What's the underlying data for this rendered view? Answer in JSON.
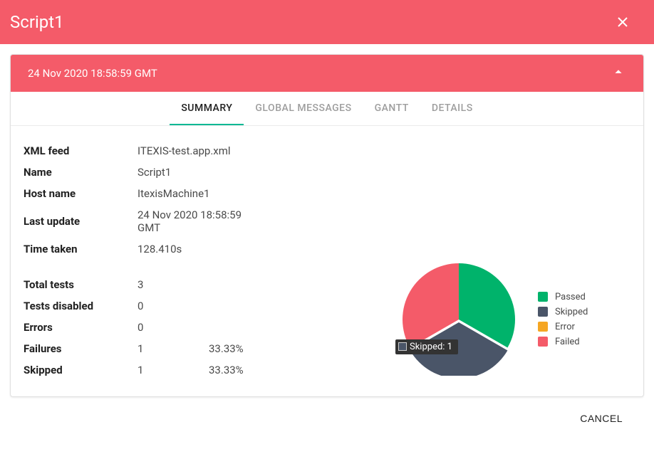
{
  "header": {
    "title": "Script1"
  },
  "panel": {
    "timestamp": "24 Nov 2020 18:58:59 GMT"
  },
  "tabs": {
    "summary": "SUMMARY",
    "global_messages": "GLOBAL MESSAGES",
    "gantt": "GANTT",
    "details": "DETAILS"
  },
  "info": {
    "xml_feed_label": "XML feed",
    "xml_feed_value": "ITEXIS-test.app.xml",
    "name_label": "Name",
    "name_value": "Script1",
    "host_label": "Host name",
    "host_value": "ItexisMachine1",
    "last_update_label": "Last update",
    "last_update_value": "24 Nov 2020 18:58:59 GMT",
    "time_taken_label": "Time taken",
    "time_taken_value": "128.410s",
    "total_tests_label": "Total tests",
    "total_tests_value": "3",
    "tests_disabled_label": "Tests disabled",
    "tests_disabled_value": "0",
    "errors_label": "Errors",
    "errors_value": "0",
    "failures_label": "Failures",
    "failures_value": "1",
    "failures_pct": "33.33%",
    "skipped_label": "Skipped",
    "skipped_value": "1",
    "skipped_pct": "33.33%"
  },
  "chart_data": {
    "type": "pie",
    "title": "",
    "series": [
      {
        "name": "Passed",
        "value": 1,
        "color": "#00b36b"
      },
      {
        "name": "Skipped",
        "value": 1,
        "color": "#4a5568"
      },
      {
        "name": "Failed",
        "value": 1,
        "color": "#f45b69"
      }
    ],
    "legend": [
      {
        "label": "Passed",
        "color": "#00b36b"
      },
      {
        "label": "Skipped",
        "color": "#4a5568"
      },
      {
        "label": "Error",
        "color": "#f5a623"
      },
      {
        "label": "Failed",
        "color": "#f45b69"
      }
    ],
    "tooltip": {
      "label": "Skipped: 1",
      "swatch": "#4a5568"
    }
  },
  "footer": {
    "cancel": "CANCEL"
  }
}
